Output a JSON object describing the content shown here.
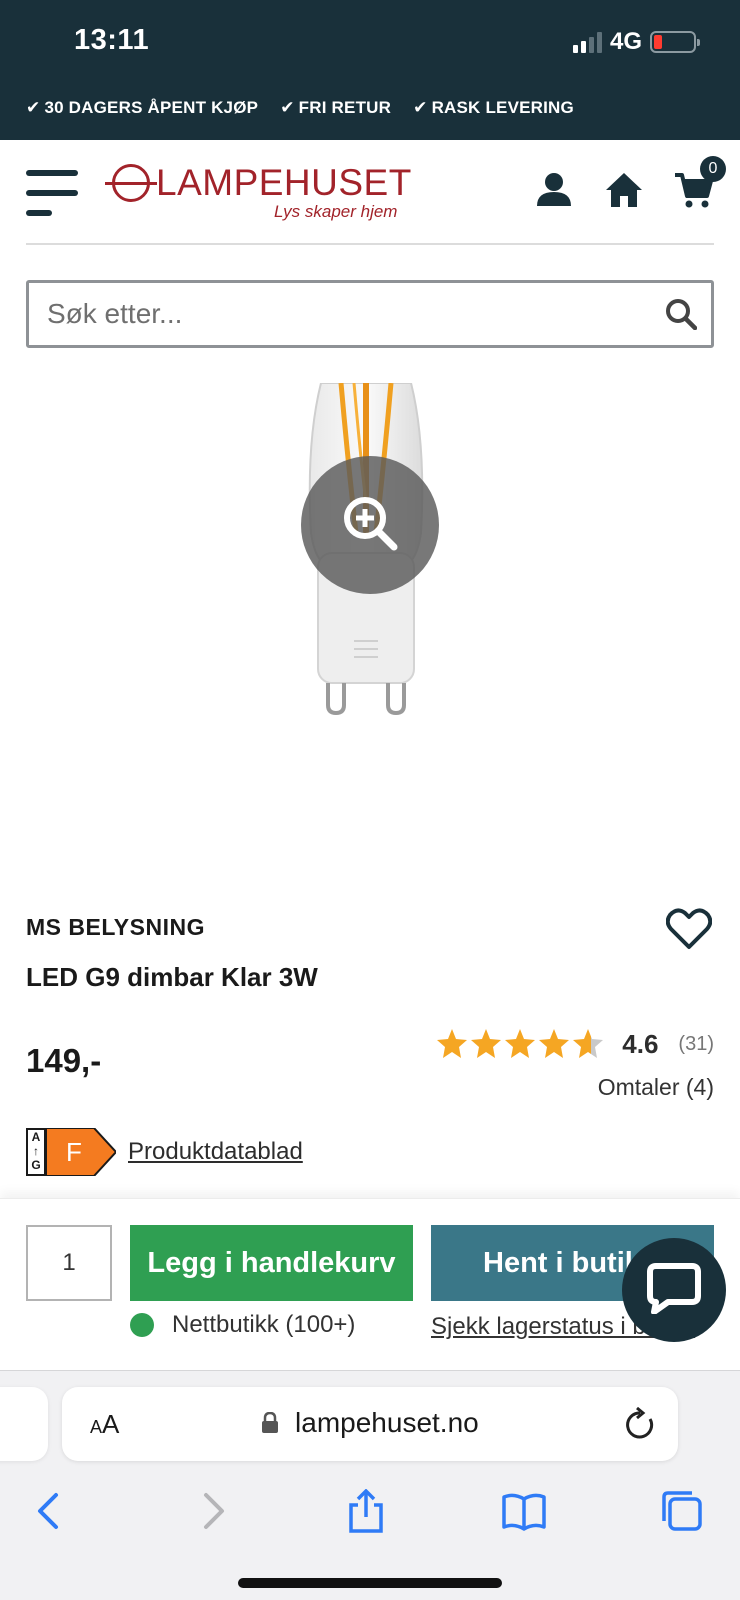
{
  "status_bar": {
    "time": "13:11",
    "network": "4G"
  },
  "usp": [
    "30 DAGERS ÅPENT KJØP",
    "FRI RETUR",
    "RASK LEVERING"
  ],
  "header": {
    "logo_text": "LAMPEHUSET",
    "logo_tagline": "Lys skaper hjem",
    "cart_count": "0"
  },
  "search": {
    "placeholder": "Søk etter..."
  },
  "product": {
    "brand": "MS BELYSNING",
    "title": "LED G9 dimbar Klar 3W",
    "price": "149,-",
    "rating_value": "4.6",
    "rating_stars": 4.6,
    "rating_count": "(31)",
    "reviews_label": "Omtaler (4)",
    "energy_scale_top": "A",
    "energy_scale_bottom": "G",
    "energy_class": "F",
    "datasheet_link": "Produktdatablad"
  },
  "buy": {
    "quantity": "1",
    "add_to_cart": "Legg i handlekurv",
    "pickup": "Hent i butikk",
    "stock_online": "Nettbutikk (100+)",
    "stock_check": "Sjekk lagerstatus i butikk"
  },
  "browser": {
    "aa_label_small": "A",
    "aa_label_large": "A",
    "url": "lampehuset.no"
  },
  "colors": {
    "header_dark": "#19303a",
    "brand_red": "#a2232a",
    "add_green": "#2f9f52",
    "pickup_teal": "#3a7788",
    "star_orange": "#f5a623",
    "energy_orange": "#f47b20"
  }
}
